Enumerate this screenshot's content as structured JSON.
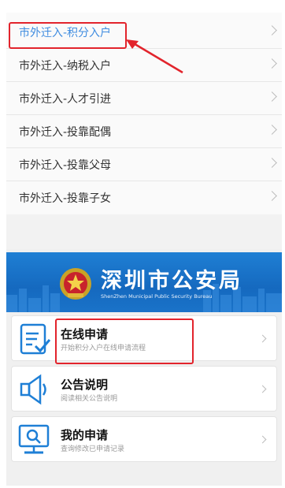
{
  "menu": {
    "items": [
      {
        "label": "市外迁入-积分入户",
        "active": true
      },
      {
        "label": "市外迁入-纳税入户",
        "active": false
      },
      {
        "label": "市外迁入-人才引进",
        "active": false
      },
      {
        "label": "市外迁入-投靠配偶",
        "active": false
      },
      {
        "label": "市外迁入-投靠父母",
        "active": false
      },
      {
        "label": "市外迁入-投靠子女",
        "active": false
      }
    ],
    "chevron_icon": "chevron-right-icon"
  },
  "banner": {
    "title": "深圳市公安局",
    "subtitle": "ShenZhen Municipal Public Security Bureau",
    "emblem_icon": "police-emblem-icon"
  },
  "cards": [
    {
      "title": "在线申请",
      "subtitle": "开始积分入户在线申请流程",
      "icon": "form-check-icon"
    },
    {
      "title": "公告说明",
      "subtitle": "阅读相关公告说明",
      "icon": "megaphone-icon"
    },
    {
      "title": "我的申请",
      "subtitle": "查询修改已申请记录",
      "icon": "monitor-search-icon"
    }
  ],
  "colors": {
    "accent_blue": "#3f8ce0",
    "highlight_red": "#e2242c",
    "banner_blue": "#1569bf",
    "icon_blue": "#1e7fd6"
  }
}
